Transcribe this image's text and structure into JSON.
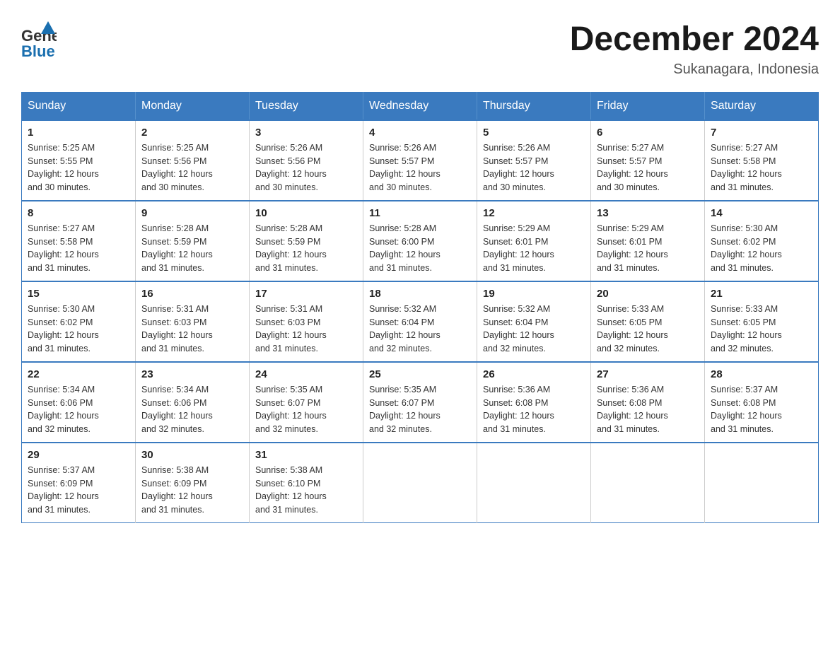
{
  "header": {
    "logo_general": "General",
    "logo_blue": "Blue",
    "month_title": "December 2024",
    "location": "Sukanagara, Indonesia"
  },
  "weekdays": [
    "Sunday",
    "Monday",
    "Tuesday",
    "Wednesday",
    "Thursday",
    "Friday",
    "Saturday"
  ],
  "weeks": [
    [
      {
        "day": "1",
        "sunrise": "5:25 AM",
        "sunset": "5:55 PM",
        "daylight": "12 hours and 30 minutes."
      },
      {
        "day": "2",
        "sunrise": "5:25 AM",
        "sunset": "5:56 PM",
        "daylight": "12 hours and 30 minutes."
      },
      {
        "day": "3",
        "sunrise": "5:26 AM",
        "sunset": "5:56 PM",
        "daylight": "12 hours and 30 minutes."
      },
      {
        "day": "4",
        "sunrise": "5:26 AM",
        "sunset": "5:57 PM",
        "daylight": "12 hours and 30 minutes."
      },
      {
        "day": "5",
        "sunrise": "5:26 AM",
        "sunset": "5:57 PM",
        "daylight": "12 hours and 30 minutes."
      },
      {
        "day": "6",
        "sunrise": "5:27 AM",
        "sunset": "5:57 PM",
        "daylight": "12 hours and 30 minutes."
      },
      {
        "day": "7",
        "sunrise": "5:27 AM",
        "sunset": "5:58 PM",
        "daylight": "12 hours and 31 minutes."
      }
    ],
    [
      {
        "day": "8",
        "sunrise": "5:27 AM",
        "sunset": "5:58 PM",
        "daylight": "12 hours and 31 minutes."
      },
      {
        "day": "9",
        "sunrise": "5:28 AM",
        "sunset": "5:59 PM",
        "daylight": "12 hours and 31 minutes."
      },
      {
        "day": "10",
        "sunrise": "5:28 AM",
        "sunset": "5:59 PM",
        "daylight": "12 hours and 31 minutes."
      },
      {
        "day": "11",
        "sunrise": "5:28 AM",
        "sunset": "6:00 PM",
        "daylight": "12 hours and 31 minutes."
      },
      {
        "day": "12",
        "sunrise": "5:29 AM",
        "sunset": "6:01 PM",
        "daylight": "12 hours and 31 minutes."
      },
      {
        "day": "13",
        "sunrise": "5:29 AM",
        "sunset": "6:01 PM",
        "daylight": "12 hours and 31 minutes."
      },
      {
        "day": "14",
        "sunrise": "5:30 AM",
        "sunset": "6:02 PM",
        "daylight": "12 hours and 31 minutes."
      }
    ],
    [
      {
        "day": "15",
        "sunrise": "5:30 AM",
        "sunset": "6:02 PM",
        "daylight": "12 hours and 31 minutes."
      },
      {
        "day": "16",
        "sunrise": "5:31 AM",
        "sunset": "6:03 PM",
        "daylight": "12 hours and 31 minutes."
      },
      {
        "day": "17",
        "sunrise": "5:31 AM",
        "sunset": "6:03 PM",
        "daylight": "12 hours and 31 minutes."
      },
      {
        "day": "18",
        "sunrise": "5:32 AM",
        "sunset": "6:04 PM",
        "daylight": "12 hours and 32 minutes."
      },
      {
        "day": "19",
        "sunrise": "5:32 AM",
        "sunset": "6:04 PM",
        "daylight": "12 hours and 32 minutes."
      },
      {
        "day": "20",
        "sunrise": "5:33 AM",
        "sunset": "6:05 PM",
        "daylight": "12 hours and 32 minutes."
      },
      {
        "day": "21",
        "sunrise": "5:33 AM",
        "sunset": "6:05 PM",
        "daylight": "12 hours and 32 minutes."
      }
    ],
    [
      {
        "day": "22",
        "sunrise": "5:34 AM",
        "sunset": "6:06 PM",
        "daylight": "12 hours and 32 minutes."
      },
      {
        "day": "23",
        "sunrise": "5:34 AM",
        "sunset": "6:06 PM",
        "daylight": "12 hours and 32 minutes."
      },
      {
        "day": "24",
        "sunrise": "5:35 AM",
        "sunset": "6:07 PM",
        "daylight": "12 hours and 32 minutes."
      },
      {
        "day": "25",
        "sunrise": "5:35 AM",
        "sunset": "6:07 PM",
        "daylight": "12 hours and 32 minutes."
      },
      {
        "day": "26",
        "sunrise": "5:36 AM",
        "sunset": "6:08 PM",
        "daylight": "12 hours and 31 minutes."
      },
      {
        "day": "27",
        "sunrise": "5:36 AM",
        "sunset": "6:08 PM",
        "daylight": "12 hours and 31 minutes."
      },
      {
        "day": "28",
        "sunrise": "5:37 AM",
        "sunset": "6:08 PM",
        "daylight": "12 hours and 31 minutes."
      }
    ],
    [
      {
        "day": "29",
        "sunrise": "5:37 AM",
        "sunset": "6:09 PM",
        "daylight": "12 hours and 31 minutes."
      },
      {
        "day": "30",
        "sunrise": "5:38 AM",
        "sunset": "6:09 PM",
        "daylight": "12 hours and 31 minutes."
      },
      {
        "day": "31",
        "sunrise": "5:38 AM",
        "sunset": "6:10 PM",
        "daylight": "12 hours and 31 minutes."
      },
      null,
      null,
      null,
      null
    ]
  ],
  "labels": {
    "sunrise": "Sunrise:",
    "sunset": "Sunset:",
    "daylight": "Daylight:"
  }
}
